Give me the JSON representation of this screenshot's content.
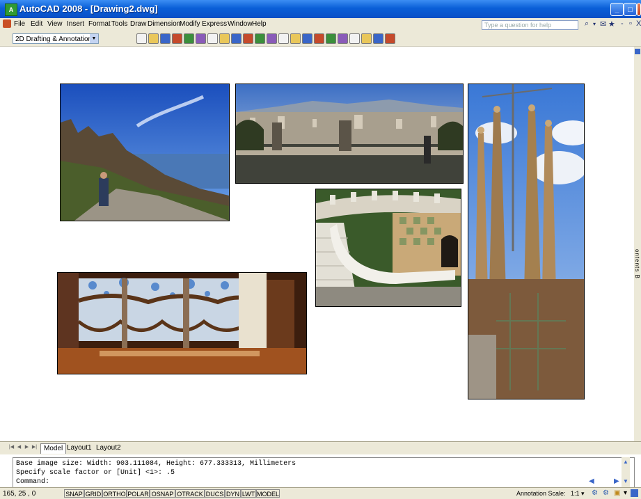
{
  "window": {
    "title": "AutoCAD 2008 - [Drawing2.dwg]",
    "app_icon_text": "A",
    "controls": {
      "minimize": "_",
      "maximize": "□",
      "close": "X"
    },
    "doc_controls": {
      "minimize": "-",
      "restore": "▫",
      "close": "X"
    }
  },
  "menu": {
    "items": [
      "File",
      "Edit",
      "View",
      "Insert",
      "Format",
      "Tools",
      "Draw",
      "Dimension",
      "Modify",
      "Express",
      "Window",
      "Help"
    ],
    "search_placeholder": "Type a question for help"
  },
  "toolbar": {
    "workspace": "2D Drafting & Annotation",
    "icons": [
      "new-icon",
      "open-icon",
      "save-icon",
      "print-icon",
      "plot-preview-icon",
      "publish-icon",
      "3d-dwf-icon",
      "cut-icon",
      "copy-icon",
      "paste-icon",
      "match-properties-icon",
      "undo-icon",
      "redo-icon",
      "pan-icon",
      "zoom-icon",
      "properties-icon",
      "design-center-icon",
      "tool-palettes-icon",
      "sheet-set-icon",
      "markup-icon",
      "calculator-icon",
      "help-icon"
    ]
  },
  "side_panel_label": "ontents B",
  "photos": [
    {
      "name": "montserrat-photo",
      "description": "Rocky mountain path with sea and blue sky"
    },
    {
      "name": "barcelona-panorama-photo",
      "description": "Panoramic view over Barcelona city"
    },
    {
      "name": "park-guell-photo",
      "description": "Mosaic staircase in Park Guell"
    },
    {
      "name": "casa-batllo-photo",
      "description": "Stained-glass window interior of Casa Batllo"
    },
    {
      "name": "sagrada-familia-photo",
      "description": "Towers of Sagrada Familia with crane"
    }
  ],
  "layout_tabs": [
    "Model",
    "Layout1",
    "Layout2"
  ],
  "command_line": {
    "lines": [
      "Base image size: Width: 903.111084, Height: 677.333313, Millimeters",
      "Specify scale factor or [Unit] <1>: .5",
      "Command:"
    ]
  },
  "status": {
    "coordinates": "165, 25 , 0",
    "toggles": [
      "SNAP",
      "GRID",
      "ORTHO",
      "POLAR",
      "OSNAP",
      "OTRACK",
      "DUCS",
      "DYN",
      "LWT",
      "MODEL"
    ],
    "annotation_scale_label": "Annotation Scale:",
    "annotation_scale_value": "1:1 ▾"
  }
}
